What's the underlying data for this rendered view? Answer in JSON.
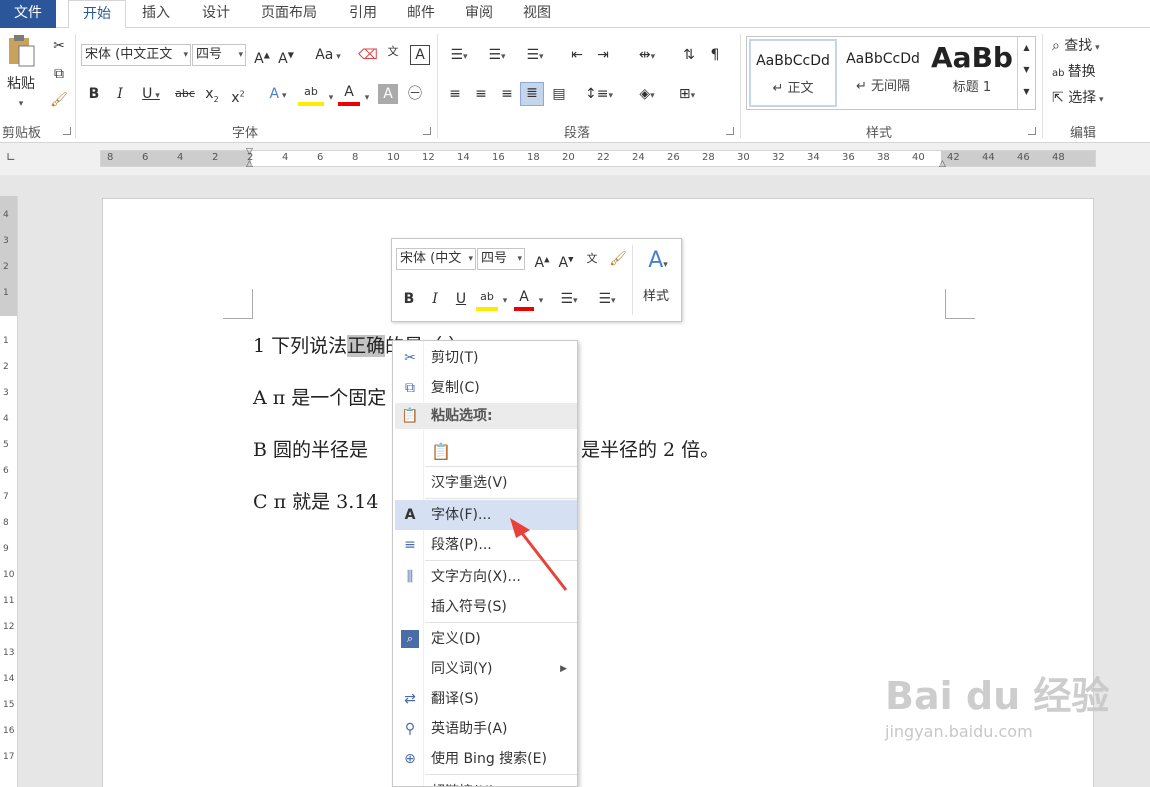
{
  "tabs": [
    {
      "label": "文件"
    },
    {
      "label": "开始"
    },
    {
      "label": "插入"
    },
    {
      "label": "设计"
    },
    {
      "label": "页面布局"
    },
    {
      "label": "引用"
    },
    {
      "label": "邮件"
    },
    {
      "label": "审阅"
    },
    {
      "label": "视图"
    }
  ],
  "ribbon": {
    "clipboard": {
      "paste": "粘贴",
      "group_label": "剪贴板"
    },
    "font": {
      "font_name": "宋体 (中文正文",
      "font_size": "四号",
      "group_label": "字体",
      "change_case": "Aa"
    },
    "paragraph": {
      "group_label": "段落"
    },
    "styles": {
      "group_label": "样式",
      "items": [
        {
          "sample": "AaBbCcDd",
          "name": "↵ 正文"
        },
        {
          "sample": "AaBbCcDd",
          "name": "↵ 无间隔"
        },
        {
          "sample": "AaBb",
          "name": "标题 1"
        }
      ]
    },
    "editing": {
      "find": "查找",
      "replace": "替换",
      "select": "选择",
      "group_label": "编辑"
    }
  },
  "ruler": {
    "ticks": [
      "8",
      "6",
      "4",
      "2",
      "2",
      "4",
      "6",
      "8",
      "10",
      "12",
      "14",
      "16",
      "18",
      "20",
      "22",
      "24",
      "26",
      "28",
      "30",
      "32",
      "34",
      "36",
      "38",
      "40",
      "42",
      "44",
      "46",
      "48"
    ],
    "vticks": [
      "4",
      "3",
      "2",
      "1",
      "1",
      "2",
      "3",
      "4",
      "5",
      "6",
      "7",
      "8",
      "9",
      "10",
      "11",
      "12",
      "13",
      "14",
      "15",
      "16",
      "17"
    ]
  },
  "document": {
    "lines": [
      {
        "pre": "1 下列说法",
        "highlight": "正确",
        "post": "的是（    ）"
      },
      {
        "pre": "A π 是一个固定",
        "highlight": "",
        "post": ""
      },
      {
        "pre": "B  圆的半径是",
        "highlight": "",
        "post": ""
      },
      {
        "pre": "C π 就是 3.14",
        "highlight": "",
        "post": ""
      }
    ],
    "line3_tail": "是半径的 2 倍。"
  },
  "mini_toolbar": {
    "font_name": "宋体 (中文",
    "font_size": "四号",
    "styles_label": "样式"
  },
  "context_menu": {
    "items": [
      {
        "label": "剪切(T)",
        "icon": "scissors-icon"
      },
      {
        "label": "复制(C)",
        "icon": "copy-icon"
      },
      {
        "label": "粘贴选项:",
        "icon": "paste-icon"
      },
      {
        "label": "汉字重选(V)",
        "icon": ""
      },
      {
        "label": "字体(F)...",
        "icon": "font-icon"
      },
      {
        "label": "段落(P)...",
        "icon": "paragraph-icon"
      },
      {
        "label": "文字方向(X)...",
        "icon": "text-direction-icon"
      },
      {
        "label": "插入符号(S)",
        "icon": ""
      },
      {
        "label": "定义(D)",
        "icon": "define-icon"
      },
      {
        "label": "同义词(Y)",
        "icon": ""
      },
      {
        "label": "翻译(S)",
        "icon": "translate-icon"
      },
      {
        "label": "英语助手(A)",
        "icon": "english-assistant-icon"
      },
      {
        "label": "使用 Bing 搜索(E)",
        "icon": "bing-search-icon"
      },
      {
        "label": "超链接(H)...",
        "icon": "hyperlink-icon"
      }
    ]
  },
  "watermark": {
    "brand": "Bai du 经验",
    "url": "jingyan.baidu.com"
  },
  "colors": {
    "file_tab": "#2b579a",
    "highlight": "#c3c3c3",
    "hover": "#d5e1f2",
    "arrow": "#e8413a"
  }
}
